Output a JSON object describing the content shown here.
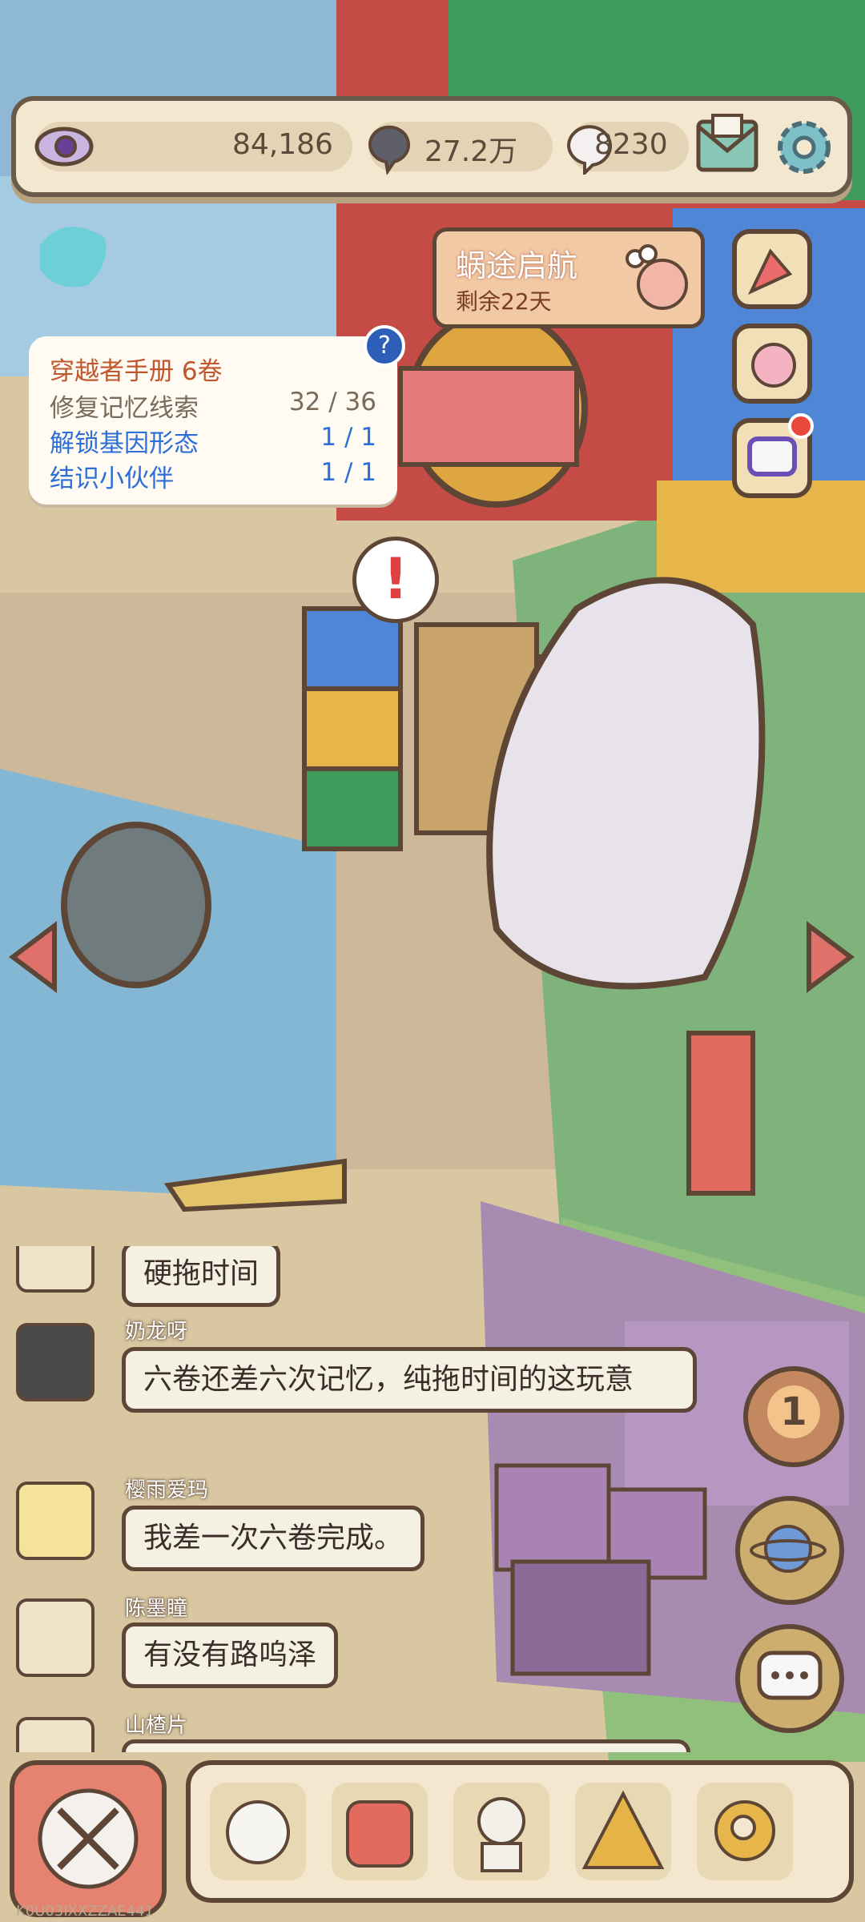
{
  "resources": {
    "eye_value": "84,186",
    "gem_value": "27.2万",
    "bubble_value": "8230"
  },
  "event": {
    "title": "蜗途启航",
    "subtitle": "剩余22天"
  },
  "quest": {
    "title": "穿越者手册 6卷",
    "items": [
      {
        "label": "修复记忆线索",
        "value": "32 / 36"
      },
      {
        "label": "解锁基因形态",
        "value": "1 / 1"
      },
      {
        "label": "结识小伙伴",
        "value": "1 / 1"
      }
    ],
    "help_symbol": "?"
  },
  "chat": {
    "messages": [
      {
        "name": "",
        "text": "硬拖时间"
      },
      {
        "name": "奶龙呀",
        "text": "六卷还差六次记忆，纯拖时间的这玩意"
      },
      {
        "name": "樱雨爱玛",
        "text": "我差一次六卷完成。"
      },
      {
        "name": "陈墨瞳",
        "text": "有没有路呜泽"
      },
      {
        "name": "山楂片",
        "text": ""
      }
    ]
  },
  "badges": {
    "floating_count": "1",
    "alert": "!"
  },
  "footer_id": "K0U03IXXZZAE441",
  "colors": {
    "frame": "#5e4636",
    "panel": "#f3e8cf",
    "quest_blue": "#2d6fd6",
    "quest_orange": "#c0562c"
  },
  "icons": {
    "eye": "eye-icon",
    "gem": "gem-icon",
    "bubble": "bubble-icon",
    "mail": "mail-icon",
    "settings": "gear-icon",
    "party": "party-popper-icon",
    "snail": "snail-icon",
    "chat_q": "chat-q-icon",
    "arrow_left": "arrow-left-icon",
    "arrow_right": "arrow-right-icon",
    "planet": "planet-icon",
    "chat": "chat-icon"
  }
}
